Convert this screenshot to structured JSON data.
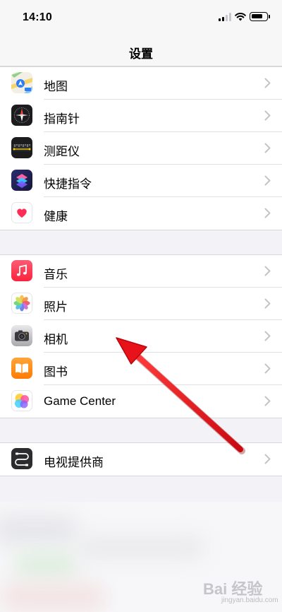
{
  "status_bar": {
    "time": "14:10",
    "battery_percent": 80
  },
  "nav": {
    "title": "设置"
  },
  "groups": [
    {
      "items": [
        {
          "label": "地图",
          "icon": "maps-icon"
        },
        {
          "label": "指南针",
          "icon": "compass-icon"
        },
        {
          "label": "测距仪",
          "icon": "measure-icon"
        },
        {
          "label": "快捷指令",
          "icon": "shortcuts-icon"
        },
        {
          "label": "健康",
          "icon": "health-icon"
        }
      ]
    },
    {
      "items": [
        {
          "label": "音乐",
          "icon": "music-icon"
        },
        {
          "label": "照片",
          "icon": "photos-icon"
        },
        {
          "label": "相机",
          "icon": "camera-icon"
        },
        {
          "label": "图书",
          "icon": "books-icon"
        },
        {
          "label": "Game Center",
          "icon": "game-center-icon"
        }
      ]
    },
    {
      "items": [
        {
          "label": "电视提供商",
          "icon": "tv-provider-icon"
        }
      ]
    }
  ],
  "watermark": {
    "text": "Bai 经验",
    "sub": "jingyan.baidu.com"
  },
  "annotation": {
    "type": "red-arrow",
    "color": "#e8121a",
    "points_to": "相机"
  }
}
